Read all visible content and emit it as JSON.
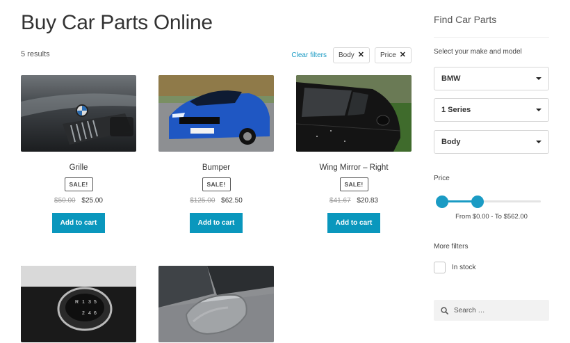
{
  "page": {
    "title": "Buy Car Parts Online",
    "result_count": "5 results"
  },
  "filters": {
    "clear_label": "Clear filters",
    "active": [
      {
        "label": "Body"
      },
      {
        "label": "Price"
      }
    ]
  },
  "products": [
    {
      "name": "Grille",
      "badge": "SALE!",
      "old_price": "$50.00",
      "new_price": "$25.00",
      "button": "Add to cart"
    },
    {
      "name": "Bumper",
      "badge": "SALE!",
      "old_price": "$125.00",
      "new_price": "$62.50",
      "button": "Add to cart"
    },
    {
      "name": "Wing Mirror – Right",
      "badge": "SALE!",
      "old_price": "$41.67",
      "new_price": "$20.83",
      "button": "Add to cart"
    },
    {
      "name": "",
      "badge": "",
      "old_price": "",
      "new_price": "",
      "button": ""
    },
    {
      "name": "",
      "badge": "",
      "old_price": "",
      "new_price": "",
      "button": ""
    }
  ],
  "sidebar": {
    "title": "Find Car Parts",
    "make_model_label": "Select your make and model",
    "selects": [
      {
        "value": "BMW"
      },
      {
        "value": "1 Series"
      },
      {
        "value": "Body"
      }
    ],
    "price_label": "Price",
    "price_slider": {
      "min_fraction": 0.0,
      "max_fraction": 0.36
    },
    "price_range_text": "From $0.00 - To $562.00",
    "more_filters_label": "More filters",
    "in_stock_label": "In stock",
    "search_placeholder": "Search …"
  },
  "colors": {
    "accent": "#1a9bc4",
    "button": "#0a97bd"
  },
  "icons": {
    "clear_chip": "close-icon",
    "select_caret": "caret-down-icon",
    "search": "search-icon"
  }
}
